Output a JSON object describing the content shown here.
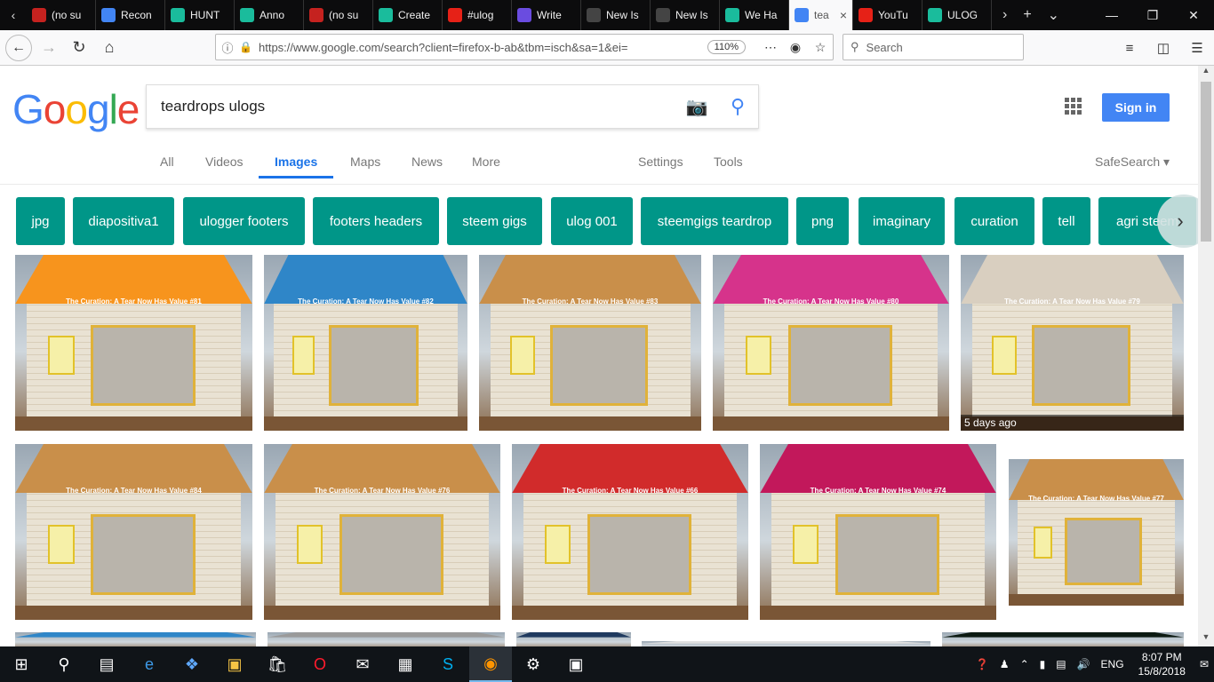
{
  "browser": {
    "tabs": [
      {
        "title": "(no su",
        "icon": "gmail-icon",
        "color": "#c5221f"
      },
      {
        "title": "Recon",
        "icon": "google-icon",
        "color": "#4285f4"
      },
      {
        "title": "HUNT",
        "icon": "steem-icon",
        "color": "#1abc9c"
      },
      {
        "title": "Anno",
        "icon": "steem-icon",
        "color": "#1abc9c"
      },
      {
        "title": "(no su",
        "icon": "gmail-icon",
        "color": "#c5221f"
      },
      {
        "title": "Create",
        "icon": "steem-icon",
        "color": "#1abc9c"
      },
      {
        "title": "#ulog",
        "icon": "youtube-icon",
        "color": "#e62117"
      },
      {
        "title": "Write",
        "icon": "write-icon",
        "color": "#6a4ce0"
      },
      {
        "title": "New Is",
        "icon": "github-icon",
        "color": "#444"
      },
      {
        "title": "New Is",
        "icon": "github-icon",
        "color": "#444"
      },
      {
        "title": "We Ha",
        "icon": "steem-icon",
        "color": "#1abc9c"
      },
      {
        "title": "tea",
        "icon": "google-icon",
        "color": "#4285f4",
        "active": true
      },
      {
        "title": "YouTu",
        "icon": "youtube-icon",
        "color": "#e62117"
      },
      {
        "title": "ULOG",
        "icon": "steem-icon",
        "color": "#1abc9c"
      }
    ],
    "url": "https://www.google.com/search?client=firefox-b-ab&tbm=isch&sa=1&ei=",
    "zoom": "110%",
    "search_placeholder": "Search"
  },
  "google": {
    "logo": [
      "G",
      "o",
      "o",
      "g",
      "l",
      "e"
    ],
    "query": "teardrops ulogs",
    "sign_in": "Sign in",
    "tabs": [
      "All",
      "Videos",
      "Images",
      "Maps",
      "News",
      "More"
    ],
    "active_tab": "Images",
    "settings": "Settings",
    "tools": "Tools",
    "safesearch": "SafeSearch ▾"
  },
  "chips": [
    "jpg",
    "diapositiva1",
    "ulogger footers",
    "footers headers",
    "steem gigs",
    "ulog 001",
    "steemgigs teardrop",
    "png",
    "imaginary",
    "curation",
    "tell",
    "agri steem"
  ],
  "images": [
    {
      "roof": "#f7941d",
      "caption": "The Curation: A Tear Now Has Value #81"
    },
    {
      "roof": "#2f86c8",
      "caption": "The Curation: A Tear Now Has Value #82"
    },
    {
      "roof": "#c98f4a",
      "caption": "The Curation: A Tear Now Has Value #83"
    },
    {
      "roof": "#d6338b",
      "caption": "The Curation: A Tear Now Has Value #80"
    },
    {
      "roof": "#d9cfc0",
      "caption": "The Curation: A Tear Now Has Value #79",
      "badge": "5 days ago"
    },
    {
      "roof": "#c98f4a",
      "caption": "The Curation: A Tear Now Has Value #84"
    },
    {
      "roof": "#c98f4a",
      "caption": "The Curation: A Tear Now Has Value #76"
    },
    {
      "roof": "#d12b2b",
      "caption": "The Curation: A Tear Now Has Value #66"
    },
    {
      "roof": "#c2185b",
      "caption": "The Curation: A Tear Now Has Value #74"
    },
    {
      "roof": "#c98f4a",
      "caption": "The Curation: A Tear Now Has Value #77"
    },
    {
      "roof": "#2f86c8",
      "caption": ""
    },
    {
      "roof": "#9a9a9a",
      "caption": ""
    },
    {
      "roof": "#1f3a5f",
      "caption": ""
    },
    {
      "roof": "#e0e0e0",
      "caption": ""
    },
    {
      "roof": "#0c1a12",
      "caption": ""
    }
  ],
  "taskbar": {
    "lang": "ENG",
    "time": "8:07 PM",
    "date": "15/8/2018"
  }
}
